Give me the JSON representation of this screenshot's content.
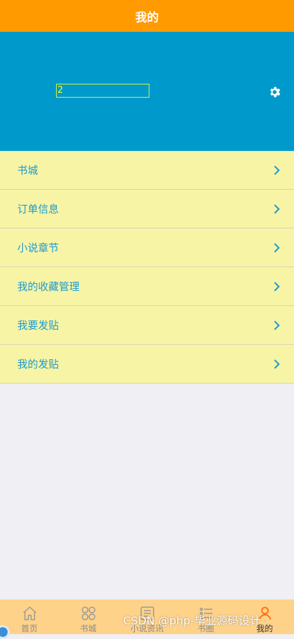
{
  "header": {
    "title": "我的"
  },
  "profile": {
    "username": "2",
    "settings_icon": "gear-icon",
    "background": "#0099cc"
  },
  "menu": {
    "items": [
      {
        "label": "书城"
      },
      {
        "label": "订单信息"
      },
      {
        "label": "小说章节"
      },
      {
        "label": "我的收藏管理"
      },
      {
        "label": "我要发贴"
      },
      {
        "label": "我的发贴"
      }
    ]
  },
  "tabbar": {
    "items": [
      {
        "label": "首页",
        "icon": "home-icon"
      },
      {
        "label": "书城",
        "icon": "grid-icon"
      },
      {
        "label": "小说资讯",
        "icon": "news-icon"
      },
      {
        "label": "书圈",
        "icon": "list-icon"
      },
      {
        "label": "我的",
        "icon": "user-icon",
        "active": true
      }
    ]
  },
  "watermark": "CSDN @php-毕业源码设计",
  "colors": {
    "header": "#ff9a00",
    "menu_bg": "#f7f4a6",
    "menu_text": "#1a9bd0",
    "tabbar": "#ffd28a",
    "active": "#ff6a00"
  }
}
